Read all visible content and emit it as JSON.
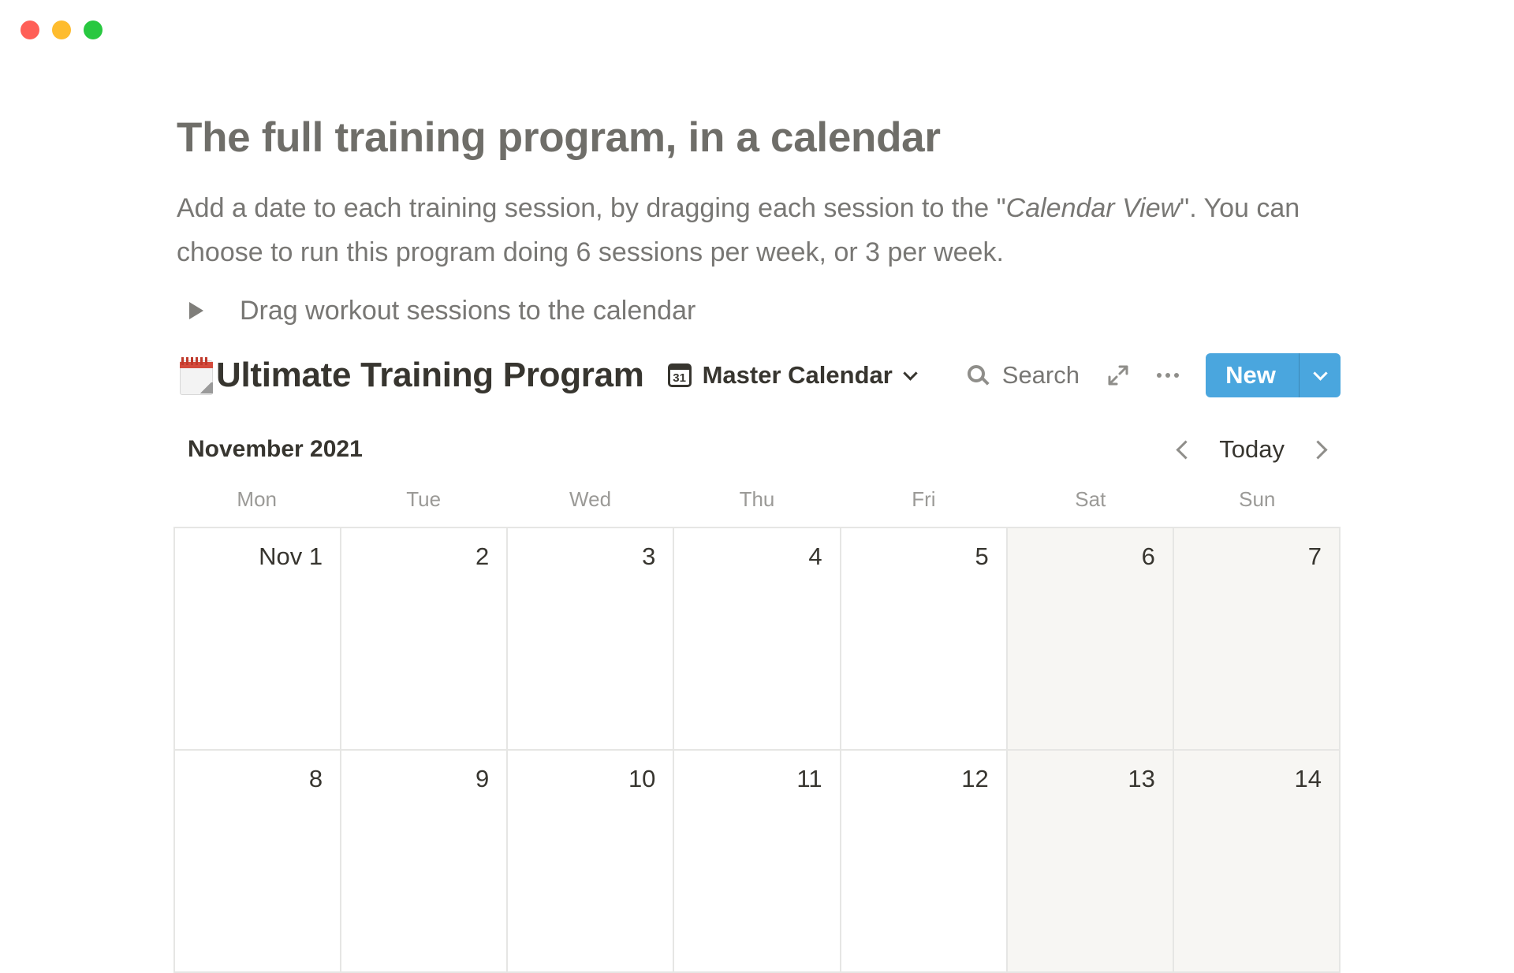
{
  "window": {
    "controls": [
      {
        "name": "close",
        "color": "#ff5f57"
      },
      {
        "name": "minimize",
        "color": "#febc2e"
      },
      {
        "name": "maximize",
        "color": "#28c840"
      }
    ]
  },
  "page": {
    "title": "The full training program, in a calendar",
    "description": {
      "part1": "Add a date to each training session, by dragging each session to the \"",
      "emphasis": "Calendar View",
      "part2": "\". You can choose to run this program doing 6 sessions per week, or 3 per week."
    },
    "toggle_label": "Drag workout sessions to the calendar"
  },
  "database": {
    "emoji_icon": "calendar-emoji-icon",
    "title": "Ultimate Training Program",
    "view": {
      "icon_text": "31",
      "label": "Master Calendar"
    },
    "search_label": "Search",
    "new_button_label": "New",
    "accent_color": "#4aa6de"
  },
  "calendar": {
    "month_label": "November 2021",
    "today_label": "Today",
    "weekdays": [
      "Mon",
      "Tue",
      "Wed",
      "Thu",
      "Fri",
      "Sat",
      "Sun"
    ],
    "weeks": [
      [
        "Nov 1",
        "2",
        "3",
        "4",
        "5",
        "6",
        "7"
      ],
      [
        "8",
        "9",
        "10",
        "11",
        "12",
        "13",
        "14"
      ]
    ]
  }
}
